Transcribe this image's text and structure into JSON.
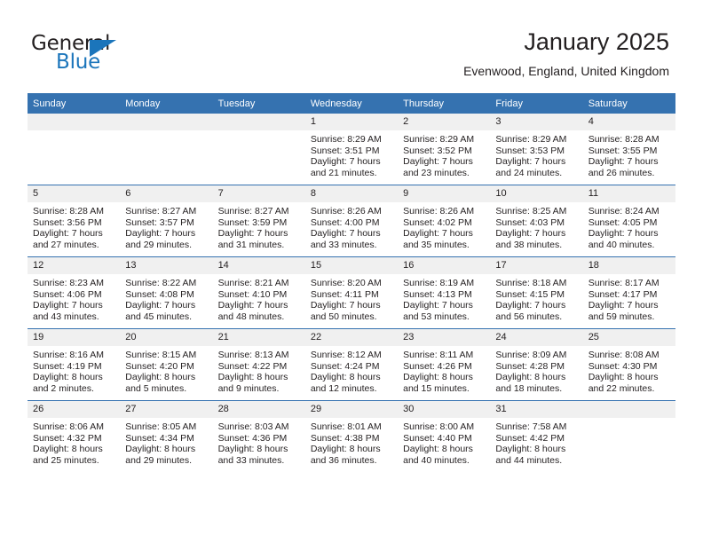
{
  "brand": {
    "name_part1": "General",
    "name_part2": "Blue",
    "accent_color": "#1b75bb",
    "triangle_icon": "triangle-icon"
  },
  "header": {
    "title": "January 2025",
    "subtitle": "Evenwood, England, United Kingdom",
    "header_bg_color": "#3572b0",
    "daynum_bg_color": "#f0f0f0"
  },
  "weekday_headers": [
    "Sunday",
    "Monday",
    "Tuesday",
    "Wednesday",
    "Thursday",
    "Friday",
    "Saturday"
  ],
  "weeks": [
    [
      {
        "day": "",
        "empty": true
      },
      {
        "day": "",
        "empty": true
      },
      {
        "day": "",
        "empty": true
      },
      {
        "day": "1",
        "sunrise": "Sunrise: 8:29 AM",
        "sunset": "Sunset: 3:51 PM",
        "daylight1": "Daylight: 7 hours",
        "daylight2": "and 21 minutes."
      },
      {
        "day": "2",
        "sunrise": "Sunrise: 8:29 AM",
        "sunset": "Sunset: 3:52 PM",
        "daylight1": "Daylight: 7 hours",
        "daylight2": "and 23 minutes."
      },
      {
        "day": "3",
        "sunrise": "Sunrise: 8:29 AM",
        "sunset": "Sunset: 3:53 PM",
        "daylight1": "Daylight: 7 hours",
        "daylight2": "and 24 minutes."
      },
      {
        "day": "4",
        "sunrise": "Sunrise: 8:28 AM",
        "sunset": "Sunset: 3:55 PM",
        "daylight1": "Daylight: 7 hours",
        "daylight2": "and 26 minutes."
      }
    ],
    [
      {
        "day": "5",
        "sunrise": "Sunrise: 8:28 AM",
        "sunset": "Sunset: 3:56 PM",
        "daylight1": "Daylight: 7 hours",
        "daylight2": "and 27 minutes."
      },
      {
        "day": "6",
        "sunrise": "Sunrise: 8:27 AM",
        "sunset": "Sunset: 3:57 PM",
        "daylight1": "Daylight: 7 hours",
        "daylight2": "and 29 minutes."
      },
      {
        "day": "7",
        "sunrise": "Sunrise: 8:27 AM",
        "sunset": "Sunset: 3:59 PM",
        "daylight1": "Daylight: 7 hours",
        "daylight2": "and 31 minutes."
      },
      {
        "day": "8",
        "sunrise": "Sunrise: 8:26 AM",
        "sunset": "Sunset: 4:00 PM",
        "daylight1": "Daylight: 7 hours",
        "daylight2": "and 33 minutes."
      },
      {
        "day": "9",
        "sunrise": "Sunrise: 8:26 AM",
        "sunset": "Sunset: 4:02 PM",
        "daylight1": "Daylight: 7 hours",
        "daylight2": "and 35 minutes."
      },
      {
        "day": "10",
        "sunrise": "Sunrise: 8:25 AM",
        "sunset": "Sunset: 4:03 PM",
        "daylight1": "Daylight: 7 hours",
        "daylight2": "and 38 minutes."
      },
      {
        "day": "11",
        "sunrise": "Sunrise: 8:24 AM",
        "sunset": "Sunset: 4:05 PM",
        "daylight1": "Daylight: 7 hours",
        "daylight2": "and 40 minutes."
      }
    ],
    [
      {
        "day": "12",
        "sunrise": "Sunrise: 8:23 AM",
        "sunset": "Sunset: 4:06 PM",
        "daylight1": "Daylight: 7 hours",
        "daylight2": "and 43 minutes."
      },
      {
        "day": "13",
        "sunrise": "Sunrise: 8:22 AM",
        "sunset": "Sunset: 4:08 PM",
        "daylight1": "Daylight: 7 hours",
        "daylight2": "and 45 minutes."
      },
      {
        "day": "14",
        "sunrise": "Sunrise: 8:21 AM",
        "sunset": "Sunset: 4:10 PM",
        "daylight1": "Daylight: 7 hours",
        "daylight2": "and 48 minutes."
      },
      {
        "day": "15",
        "sunrise": "Sunrise: 8:20 AM",
        "sunset": "Sunset: 4:11 PM",
        "daylight1": "Daylight: 7 hours",
        "daylight2": "and 50 minutes."
      },
      {
        "day": "16",
        "sunrise": "Sunrise: 8:19 AM",
        "sunset": "Sunset: 4:13 PM",
        "daylight1": "Daylight: 7 hours",
        "daylight2": "and 53 minutes."
      },
      {
        "day": "17",
        "sunrise": "Sunrise: 8:18 AM",
        "sunset": "Sunset: 4:15 PM",
        "daylight1": "Daylight: 7 hours",
        "daylight2": "and 56 minutes."
      },
      {
        "day": "18",
        "sunrise": "Sunrise: 8:17 AM",
        "sunset": "Sunset: 4:17 PM",
        "daylight1": "Daylight: 7 hours",
        "daylight2": "and 59 minutes."
      }
    ],
    [
      {
        "day": "19",
        "sunrise": "Sunrise: 8:16 AM",
        "sunset": "Sunset: 4:19 PM",
        "daylight1": "Daylight: 8 hours",
        "daylight2": "and 2 minutes."
      },
      {
        "day": "20",
        "sunrise": "Sunrise: 8:15 AM",
        "sunset": "Sunset: 4:20 PM",
        "daylight1": "Daylight: 8 hours",
        "daylight2": "and 5 minutes."
      },
      {
        "day": "21",
        "sunrise": "Sunrise: 8:13 AM",
        "sunset": "Sunset: 4:22 PM",
        "daylight1": "Daylight: 8 hours",
        "daylight2": "and 9 minutes."
      },
      {
        "day": "22",
        "sunrise": "Sunrise: 8:12 AM",
        "sunset": "Sunset: 4:24 PM",
        "daylight1": "Daylight: 8 hours",
        "daylight2": "and 12 minutes."
      },
      {
        "day": "23",
        "sunrise": "Sunrise: 8:11 AM",
        "sunset": "Sunset: 4:26 PM",
        "daylight1": "Daylight: 8 hours",
        "daylight2": "and 15 minutes."
      },
      {
        "day": "24",
        "sunrise": "Sunrise: 8:09 AM",
        "sunset": "Sunset: 4:28 PM",
        "daylight1": "Daylight: 8 hours",
        "daylight2": "and 18 minutes."
      },
      {
        "day": "25",
        "sunrise": "Sunrise: 8:08 AM",
        "sunset": "Sunset: 4:30 PM",
        "daylight1": "Daylight: 8 hours",
        "daylight2": "and 22 minutes."
      }
    ],
    [
      {
        "day": "26",
        "sunrise": "Sunrise: 8:06 AM",
        "sunset": "Sunset: 4:32 PM",
        "daylight1": "Daylight: 8 hours",
        "daylight2": "and 25 minutes."
      },
      {
        "day": "27",
        "sunrise": "Sunrise: 8:05 AM",
        "sunset": "Sunset: 4:34 PM",
        "daylight1": "Daylight: 8 hours",
        "daylight2": "and 29 minutes."
      },
      {
        "day": "28",
        "sunrise": "Sunrise: 8:03 AM",
        "sunset": "Sunset: 4:36 PM",
        "daylight1": "Daylight: 8 hours",
        "daylight2": "and 33 minutes."
      },
      {
        "day": "29",
        "sunrise": "Sunrise: 8:01 AM",
        "sunset": "Sunset: 4:38 PM",
        "daylight1": "Daylight: 8 hours",
        "daylight2": "and 36 minutes."
      },
      {
        "day": "30",
        "sunrise": "Sunrise: 8:00 AM",
        "sunset": "Sunset: 4:40 PM",
        "daylight1": "Daylight: 8 hours",
        "daylight2": "and 40 minutes."
      },
      {
        "day": "31",
        "sunrise": "Sunrise: 7:58 AM",
        "sunset": "Sunset: 4:42 PM",
        "daylight1": "Daylight: 8 hours",
        "daylight2": "and 44 minutes."
      },
      {
        "day": "",
        "empty": true
      }
    ]
  ]
}
